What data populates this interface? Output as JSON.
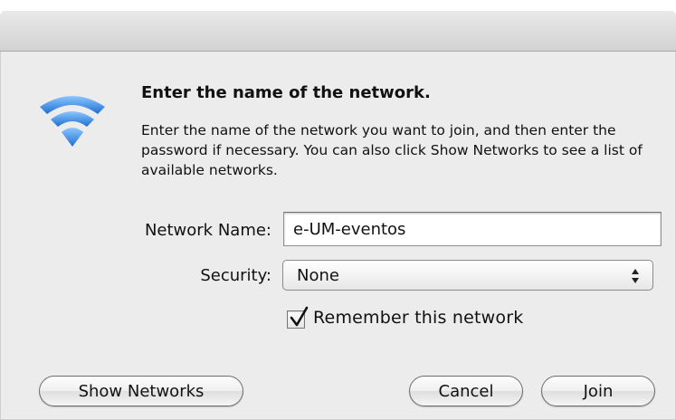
{
  "dialog": {
    "heading": "Enter the name of the network.",
    "description": "Enter the name of the network you want to join, and then enter the password if necessary. You can also click Show Networks to see a list of available networks."
  },
  "form": {
    "network_name_label": "Network Name:",
    "network_name_value": "e-UM-eventos",
    "security_label": "Security:",
    "security_value": "None",
    "remember_label": "Remember this network",
    "remember_checked": true
  },
  "buttons": {
    "show_networks": "Show Networks",
    "cancel": "Cancel",
    "join": "Join"
  },
  "icons": {
    "network_icon": "wifi-icon",
    "security_stepper": "stepper-icon",
    "checkbox_mark": "check-mark-icon"
  },
  "colors": {
    "wifi_blue": "#3a8fe0",
    "dialog_background": "#ececec"
  }
}
